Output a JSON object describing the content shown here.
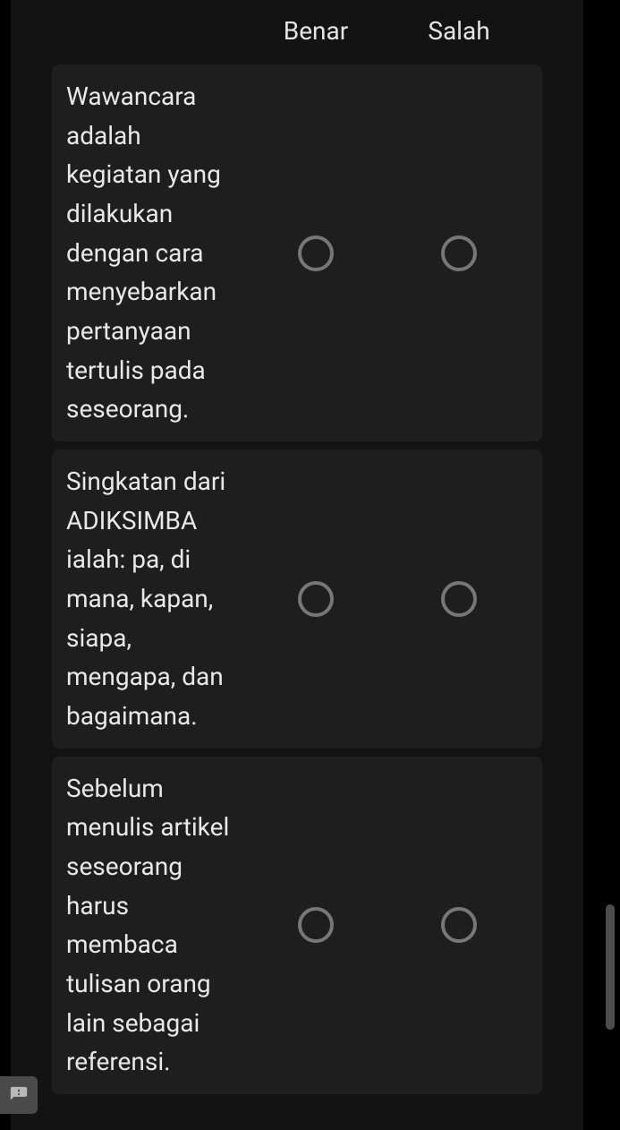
{
  "table": {
    "columns": {
      "col1": "Benar",
      "col2": "Salah"
    },
    "rows": [
      {
        "statement": "Wawancara adalah kegiatan yang dilakukan dengan cara menyebarkan pertanyaan tertulis pada seseorang."
      },
      {
        "statement": "Singkatan dari ADIKSIMBA ialah: pa, di mana, kapan, siapa, mengapa, dan bagaimana."
      },
      {
        "statement": "Sebelum menulis artikel seseorang harus membaca tulisan orang lain sebagai referensi."
      }
    ]
  }
}
